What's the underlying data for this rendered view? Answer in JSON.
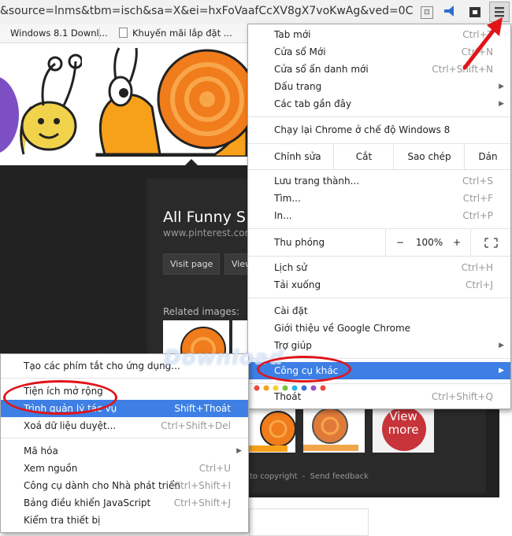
{
  "url_text": "&source=lnms&tbm=isch&sa=X&ei=hxFoVaafCcXV8gX7voKwAg&ved=0C",
  "bookmarks": [
    "Windows 8.1 Downl...",
    "Khuyến mãi lắp đặt ..."
  ],
  "page": {
    "title": "All Funny S",
    "site": "www.pinterest.com",
    "visit_label": "Visit page",
    "view_label": "View",
    "related_label": "Related images:",
    "view_more": "View more",
    "footer_copy": "to copyright",
    "footer_sep": "-",
    "footer_feedback": "Send feedback",
    "watermark": "Download"
  },
  "main_menu": {
    "items1": [
      {
        "label": "Tab mới",
        "shortcut": "Ctrl+T"
      },
      {
        "label": "Cửa sổ Mới",
        "shortcut": "Ctrl+N"
      },
      {
        "label": "Cửa sổ ẩn danh mới",
        "shortcut": "Ctrl+Shift+N"
      },
      {
        "label": "Dấu trang",
        "shortcut": ""
      },
      {
        "label": "Các tab gần đây",
        "shortcut": ""
      }
    ],
    "relaunch": "Chạy lại Chrome ở chế độ Windows 8",
    "edit": {
      "label": "Chỉnh sửa",
      "cut": "Cắt",
      "copy": "Sao chép",
      "paste": "Dán"
    },
    "items2": [
      {
        "label": "Lưu trang thành...",
        "shortcut": "Ctrl+S"
      },
      {
        "label": "Tìm...",
        "shortcut": "Ctrl+F"
      },
      {
        "label": "In...",
        "shortcut": "Ctrl+P"
      }
    ],
    "zoom": {
      "label": "Thu phóng",
      "minus": "−",
      "value": "100%",
      "plus": "+"
    },
    "items3": [
      {
        "label": "Lịch sử",
        "shortcut": "Ctrl+H"
      },
      {
        "label": "Tải xuống",
        "shortcut": "Ctrl+J"
      }
    ],
    "items4": [
      {
        "label": "Cài đặt"
      },
      {
        "label": "Giới thiệu về Google Chrome"
      },
      {
        "label": "Trợ giúp"
      }
    ],
    "more_tools": "Công cụ khác",
    "exit": {
      "label": "Thoát",
      "shortcut": "Ctrl+Shift+Q"
    }
  },
  "sub_menu": {
    "create_shortcuts": "Tạo các phím tắt cho ứng dụng...",
    "extensions": "Tiện ích mở rộng",
    "task_manager": {
      "label": "Trình quản lý tác vụ",
      "shortcut": "Shift+Thoát"
    },
    "clear_data": {
      "label": "Xoá dữ liệu duyệt...",
      "shortcut": "Ctrl+Shift+Del"
    },
    "encoding": "Mã hóa",
    "view_source": {
      "label": "Xem nguồn",
      "shortcut": "Ctrl+U"
    },
    "dev_tools": {
      "label": "Công cụ dành cho Nhà phát triển",
      "shortcut": "Ctrl+Shift+I"
    },
    "js_console": {
      "label": "Bảng điều khiển JavaScript",
      "shortcut": "Ctrl+Shift+J"
    },
    "inspect": "Kiểm tra thiết bị"
  },
  "colors": {
    "highlight": "#3d7fe4",
    "annotation_red": "#e01419",
    "snail_orange": "#f07c1c"
  }
}
